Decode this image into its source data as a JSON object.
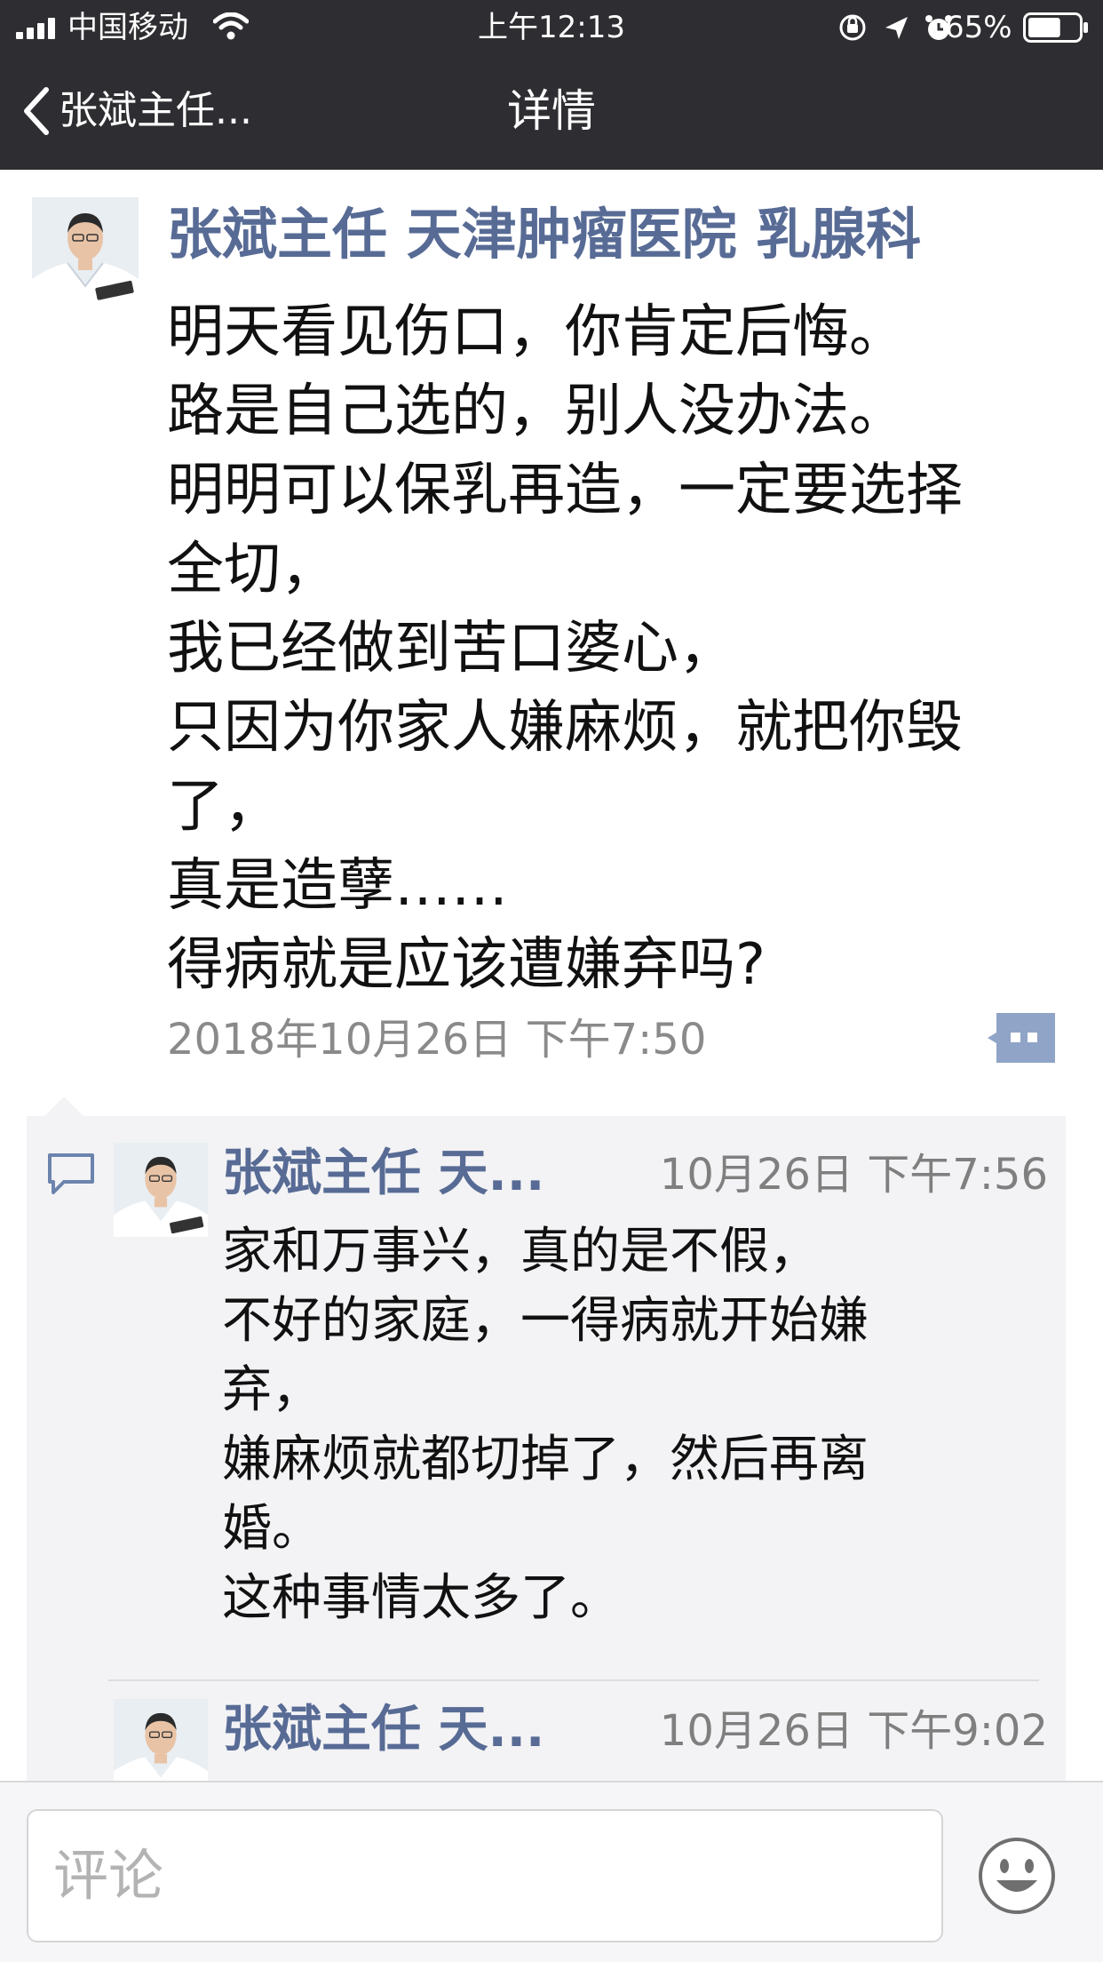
{
  "status_bar": {
    "carrier": "中国移动",
    "time": "上午12:13",
    "battery": "65%",
    "battery_level": 0.65
  },
  "nav": {
    "back_label": "张斌主任...",
    "title": "详情"
  },
  "post": {
    "author": "张斌主任 天津肿瘤医院 乳腺科",
    "lines": [
      "明天看见伤口，你肯定后悔。",
      "路是自己选的，别人没办法。",
      "明明可以保乳再造，一定要选择",
      "全切，",
      "我已经做到苦口婆心，",
      "只因为你家人嫌麻烦，就把你毁",
      "了，",
      "真是造孽……",
      "得病就是应该遭嫌弃吗?"
    ],
    "timestamp": "2018年10月26日 下午7:50"
  },
  "comments": [
    {
      "author": "张斌主任 天...",
      "time": "10月26日 下午7:56",
      "lines": [
        "家和万事兴，真的是不假，",
        "不好的家庭，一得病就开始嫌",
        "弃，",
        "嫌麻烦就都切掉了，然后再离",
        "婚。",
        "这种事情太多了。"
      ]
    },
    {
      "author": "张斌主任 天...",
      "time": "10月26日 下午9:02",
      "lines": []
    }
  ],
  "input": {
    "placeholder": "评论"
  },
  "colors": {
    "nav_bg": "#2e2e32",
    "name_link": "#576b95",
    "comments_bg": "#f3f3f5"
  },
  "icons": [
    "signal-icon",
    "wifi-icon",
    "lock-rotation-icon",
    "location-icon",
    "alarm-icon",
    "battery-icon",
    "back-chevron-icon",
    "more-actions-icon",
    "comment-bubble-icon",
    "emoji-icon"
  ]
}
